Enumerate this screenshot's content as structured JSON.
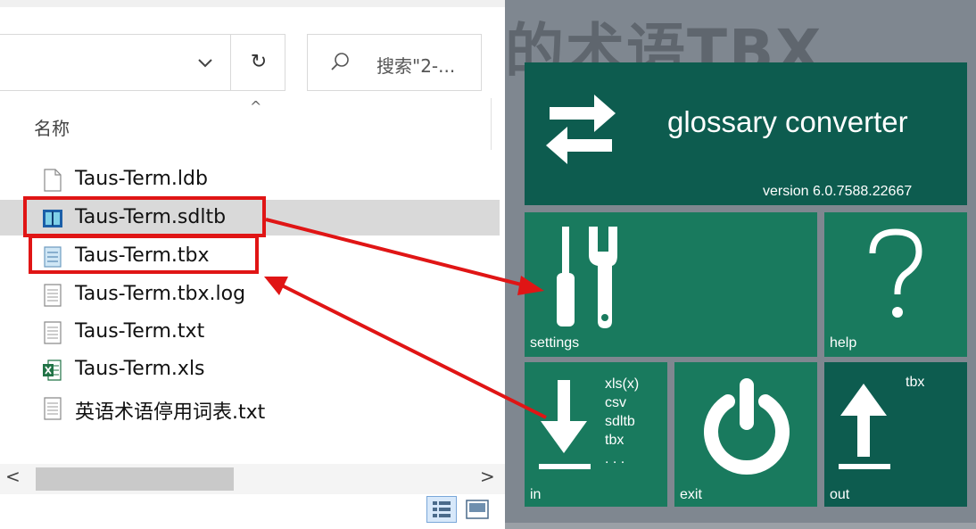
{
  "explorer": {
    "refresh_glyph": "↻",
    "search_placeholder": "搜索\"2-...",
    "column_header": "名称",
    "sort_arrow": "^",
    "files": [
      {
        "name": "Taus-Term.ldb",
        "icon": "blank-file-icon"
      },
      {
        "name": "Taus-Term.sdltb",
        "icon": "sdltb-file-icon"
      },
      {
        "name": "Taus-Term.tbx",
        "icon": "tbx-file-icon"
      },
      {
        "name": "Taus-Term.tbx.log",
        "icon": "text-file-icon"
      },
      {
        "name": "Taus-Term.txt",
        "icon": "text-file-icon"
      },
      {
        "name": "Taus-Term.xls",
        "icon": "excel-file-icon"
      },
      {
        "name": "英语术语停用词表.txt",
        "icon": "text-file-icon"
      }
    ],
    "scroll_left": "<",
    "scroll_right": ">"
  },
  "backdrop": {
    "text": "的术语TBX"
  },
  "converter": {
    "app_name": "glossary converter",
    "version": "version 6.0.7588.22667",
    "settings_label": "settings",
    "help_label": "help",
    "in_label": "in",
    "exit_label": "exit",
    "out_label": "out",
    "in_formats": [
      "xls(x)",
      "csv",
      "sdltb",
      "tbx",
      ". . ."
    ],
    "out_format": "tbx",
    "colors": {
      "tile_dark": "#0d5c4f",
      "tile_light": "#197a5e",
      "annotation_red": "#e01515"
    }
  }
}
